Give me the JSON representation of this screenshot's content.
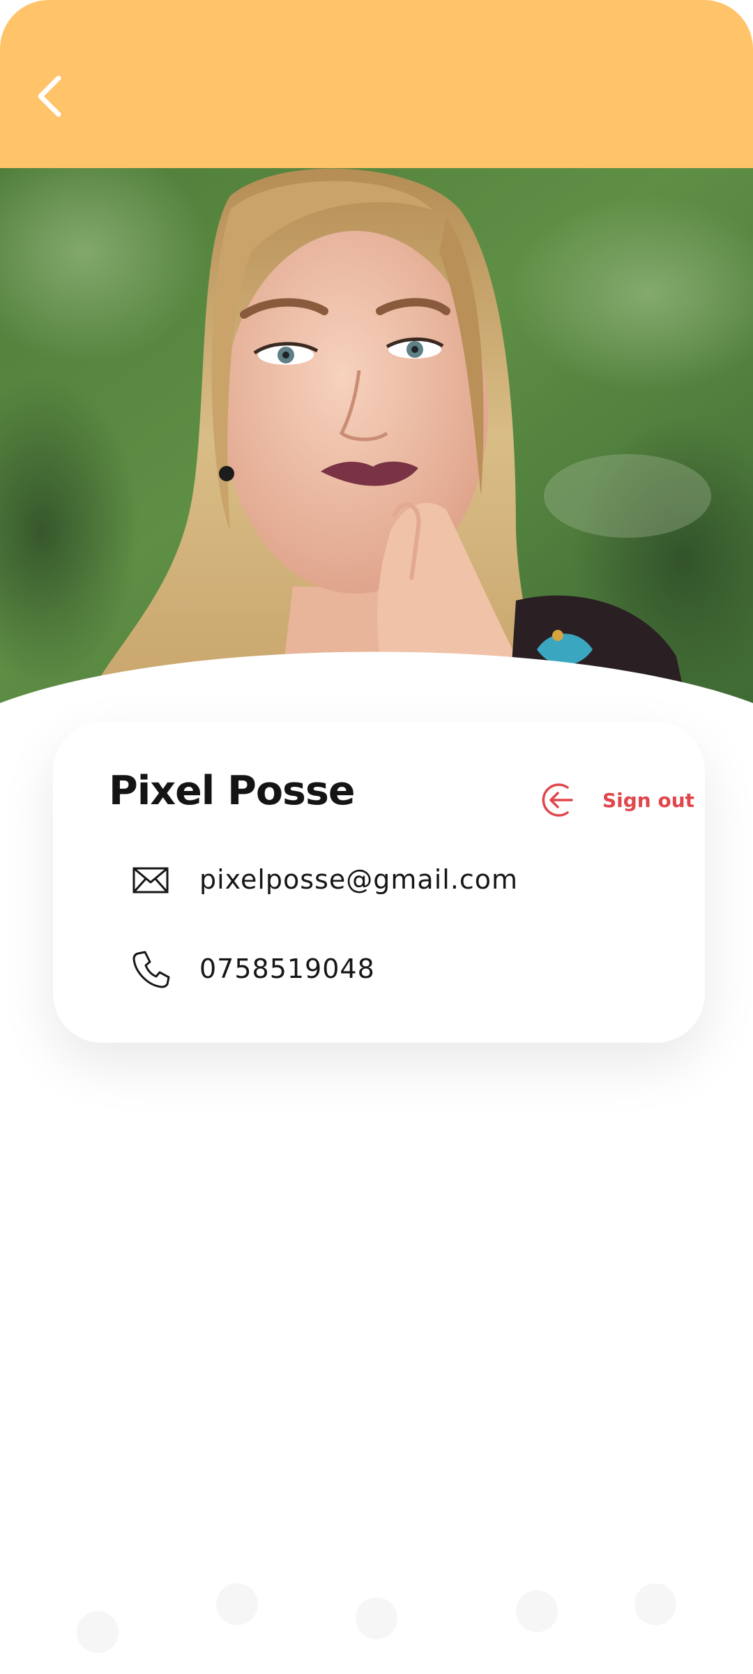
{
  "header": {
    "background_color": "#FFC369",
    "back_icon": "chevron-left-icon"
  },
  "profile": {
    "photo": "profile-photo",
    "name": "Pixel Posse",
    "sign_out_label": "Sign out",
    "sign_out_icon": "sign-out-arrow-icon",
    "accent_color": "#E0464B",
    "email": "pixelposse@gmail.com",
    "email_icon": "envelope-icon",
    "phone": "0758519048",
    "phone_icon": "phone-icon"
  }
}
